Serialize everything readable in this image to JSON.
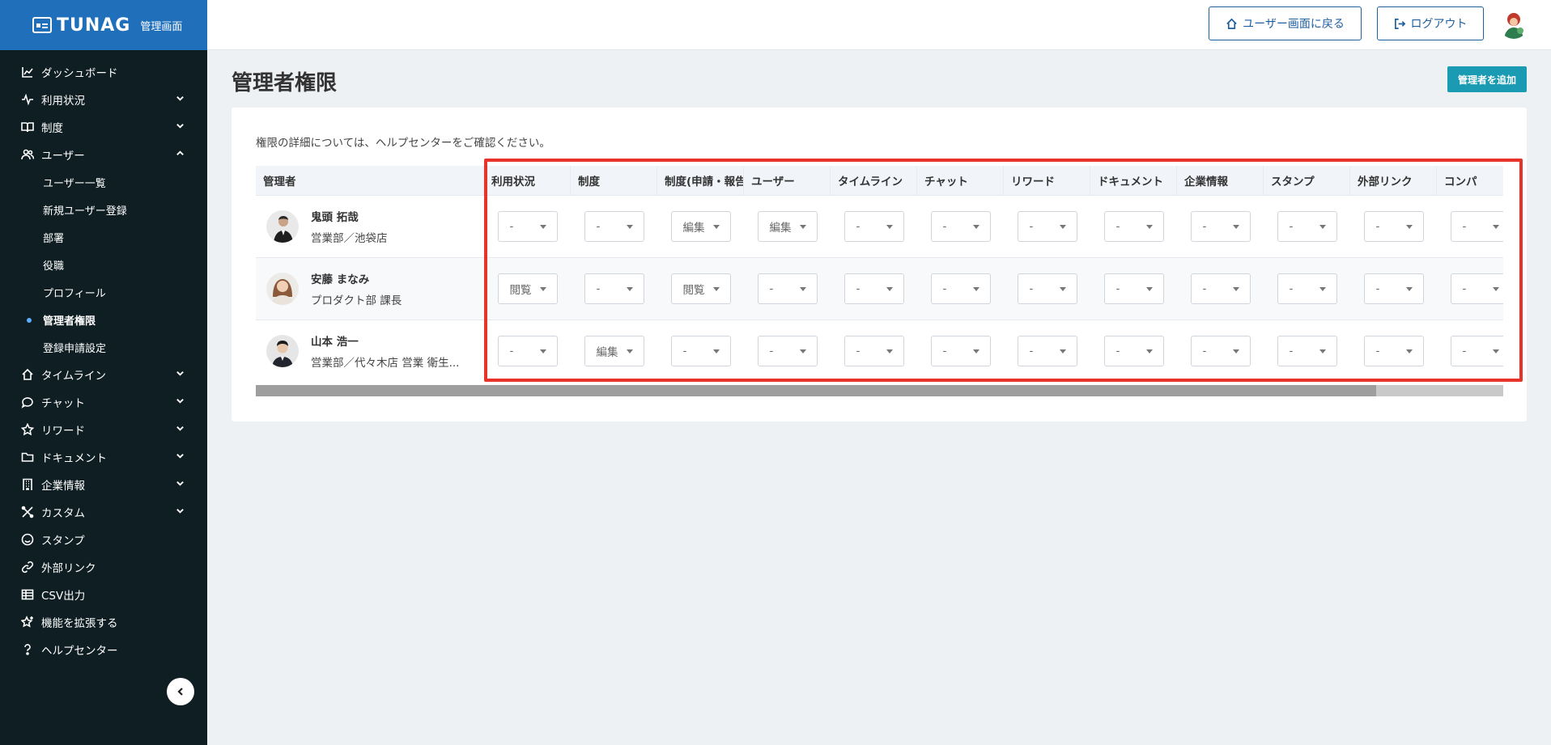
{
  "app": {
    "logo_text": "TUNAG",
    "logo_sub": "管理画面"
  },
  "header": {
    "home_button": "ユーザー画面に戻る",
    "logout_button": "ログアウト"
  },
  "sidebar": {
    "items": [
      {
        "label": "ダッシュボード",
        "icon": "chart-line-icon"
      },
      {
        "label": "利用状況",
        "icon": "activity-icon",
        "expandable": true
      },
      {
        "label": "制度",
        "icon": "book-icon",
        "expandable": true
      },
      {
        "label": "ユーザー",
        "icon": "users-icon",
        "expandable": true,
        "expanded": true
      },
      {
        "label": "タイムライン",
        "icon": "home-icon",
        "expandable": true
      },
      {
        "label": "チャット",
        "icon": "chat-icon",
        "expandable": true
      },
      {
        "label": "リワード",
        "icon": "star-icon",
        "expandable": true
      },
      {
        "label": "ドキュメント",
        "icon": "folder-icon",
        "expandable": true
      },
      {
        "label": "企業情報",
        "icon": "building-icon",
        "expandable": true
      },
      {
        "label": "カスタム",
        "icon": "tools-icon",
        "expandable": true
      },
      {
        "label": "スタンプ",
        "icon": "smile-icon"
      },
      {
        "label": "外部リンク",
        "icon": "link-icon"
      },
      {
        "label": "CSV出力",
        "icon": "table-icon"
      },
      {
        "label": "機能を拡張する",
        "icon": "star-plus-icon"
      },
      {
        "label": "ヘルプセンター",
        "icon": "question-icon"
      }
    ],
    "user_subitems": [
      "ユーザー一覧",
      "新規ユーザー登録",
      "部署",
      "役職",
      "プロフィール",
      "管理者権限",
      "登録申請設定"
    ],
    "active_subitem": "管理者権限"
  },
  "main": {
    "title": "管理者権限",
    "add_button": "管理者を追加",
    "note": "権限の詳細については、ヘルプセンターをご確認ください。",
    "table": {
      "admin_header": "管理者",
      "columns": [
        "利用状況",
        "制度",
        "制度(申請・報告)",
        "ユーザー",
        "タイムライン",
        "チャット",
        "リワード",
        "ドキュメント",
        "企業情報",
        "スタンプ",
        "外部リンク",
        "コンパ"
      ],
      "rows": [
        {
          "name": "鬼頭 拓哉",
          "dept": "営業部／池袋店",
          "values": [
            "-",
            "-",
            "編集",
            "編集",
            "-",
            "-",
            "-",
            "-",
            "-",
            "-",
            "-",
            "-"
          ]
        },
        {
          "name": "安藤 まなみ",
          "dept": "プロダクト部 課長",
          "values": [
            "閲覧",
            "-",
            "閲覧",
            "-",
            "-",
            "-",
            "-",
            "-",
            "-",
            "-",
            "-",
            "-"
          ]
        },
        {
          "name": "山本 浩一",
          "dept": "営業部／代々木店 営業 衛生...",
          "values": [
            "-",
            "編集",
            "-",
            "-",
            "-",
            "-",
            "-",
            "-",
            "-",
            "-",
            "-",
            "-"
          ]
        }
      ]
    }
  },
  "colors": {
    "brand_blue": "#1f6fbb",
    "sidebar_bg": "#0f1e23",
    "accent_teal": "#1a9bb3",
    "highlight_red": "#e8332a"
  }
}
